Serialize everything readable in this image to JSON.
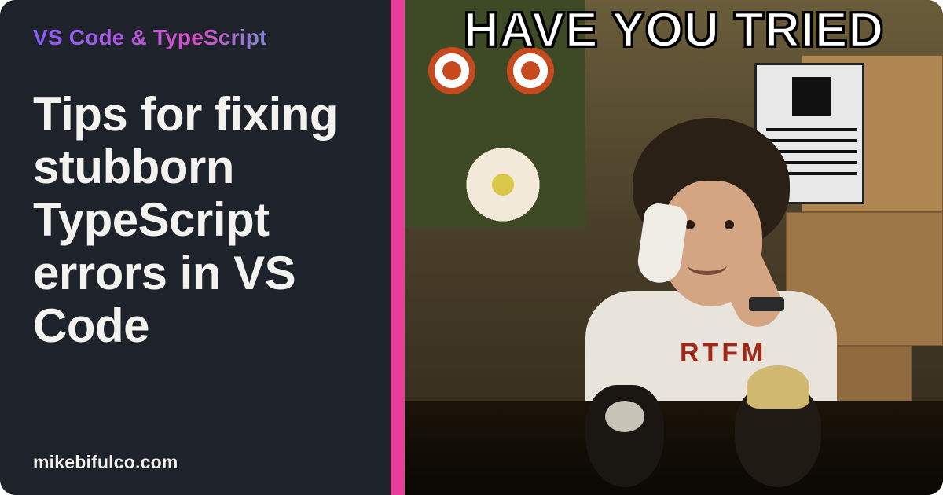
{
  "card": {
    "eyebrow": "VS Code & TypeScript",
    "headline": "Tips for fixing stubborn TypeScript errors in VS Code",
    "site": "mikebifulco.com"
  },
  "meme": {
    "caption": "HAVE YOU TRIED",
    "shirt_text": "RTFM"
  },
  "colors": {
    "panel_bg": "#1e222a",
    "accent_strip": "#e83d99",
    "text": "#f4f2ef"
  }
}
